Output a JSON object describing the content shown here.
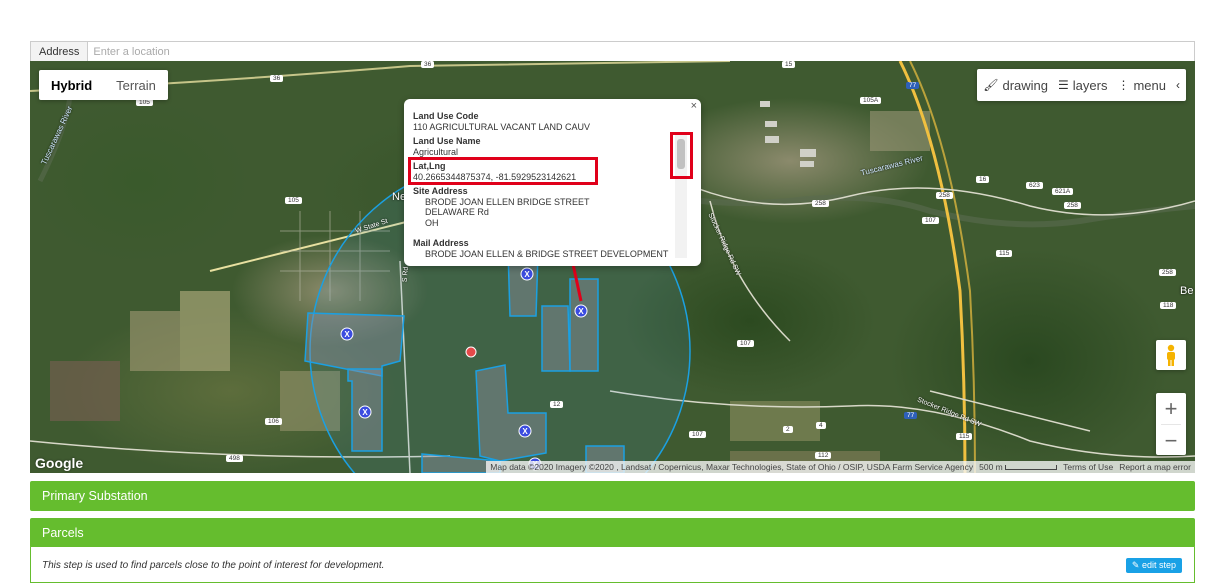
{
  "address": {
    "label": "Address",
    "placeholder": "Enter a location"
  },
  "map": {
    "map_types": [
      "Hybrid",
      "Terrain"
    ],
    "active_type": "Hybrid",
    "toolbar": {
      "drawing": "drawing",
      "layers": "layers",
      "menu": "menu"
    },
    "google_logo": "Google",
    "attribution": "Map data ©2020 Imagery ©2020 , Landsat / Copernicus, Maxar Technologies, State of Ohio / OSIP, USDA Farm Service Agency",
    "scale": "500 m",
    "terms": "Terms of Use",
    "report": "Report a map error",
    "zoom_in": "+",
    "zoom_out": "−",
    "road_labels": {
      "ne": "Ne",
      "be": "Be",
      "state_st": "W State St",
      "stocker1": "Stocker Ridge Rd SW",
      "stocker2": "Stocker Ridge Rd SW",
      "tusc1": "Tuscarawas River",
      "tusc2": "Tuscarawas River",
      "srd": "S Rd"
    },
    "shields": [
      "36",
      "36",
      "15",
      "105",
      "105",
      "105",
      "77",
      "105A",
      "105",
      "258",
      "258",
      "107",
      "115",
      "16",
      "623",
      "621A",
      "258",
      "258",
      "118",
      "107",
      "106",
      "107",
      "498",
      "2",
      "4",
      "12",
      "112",
      "115",
      "77"
    ]
  },
  "info_window": {
    "close": "×",
    "land_use_code_label": "Land Use Code",
    "land_use_code": "110 AGRICULTURAL VACANT LAND CAUV",
    "land_use_name_label": "Land Use Name",
    "land_use_name": "Agricultural",
    "latlng_label": "Lat,Lng",
    "latlng": "40.2665344875374, -81.5929523142621",
    "site_address_label": "Site Address",
    "site_address": [
      "BRODE JOAN ELLEN BRIDGE STREET",
      "DELAWARE Rd",
      "OH"
    ],
    "mail_address_label": "Mail Address",
    "mail_address_line": "BRODE JOAN ELLEN & BRIDGE STREET DEVELOPMENT"
  },
  "panels": {
    "primary_substation": "Primary Substation",
    "parcels": "Parcels",
    "parcels_desc": "This step is used to find parcels close to the point of interest for development.",
    "edit_step": "edit step"
  }
}
